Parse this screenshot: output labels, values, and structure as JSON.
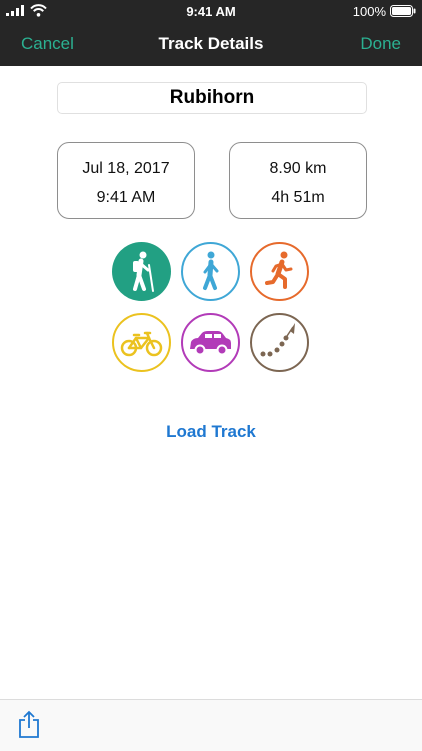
{
  "status_bar": {
    "time": "9:41 AM",
    "battery": "100%"
  },
  "nav": {
    "cancel": "Cancel",
    "title": "Track Details",
    "done": "Done"
  },
  "track": {
    "name": "Rubihorn",
    "date": "Jul 18, 2017",
    "time": "9:41 AM",
    "distance": "8.90 km",
    "duration": "4h 51m"
  },
  "activities": [
    {
      "name": "hiking-icon",
      "color": "#22a083",
      "selected": true
    },
    {
      "name": "walking-icon",
      "color": "#3fa7d6",
      "selected": false
    },
    {
      "name": "running-icon",
      "color": "#e66a2c",
      "selected": false
    },
    {
      "name": "cycling-icon",
      "color": "#ebc21f",
      "selected": false
    },
    {
      "name": "car-icon",
      "color": "#b23bb8",
      "selected": false
    },
    {
      "name": "other-track-icon",
      "color": "#7c6652",
      "selected": false
    }
  ],
  "load_track": "Load Track",
  "toolbar": {
    "share_icon": "share-icon"
  }
}
